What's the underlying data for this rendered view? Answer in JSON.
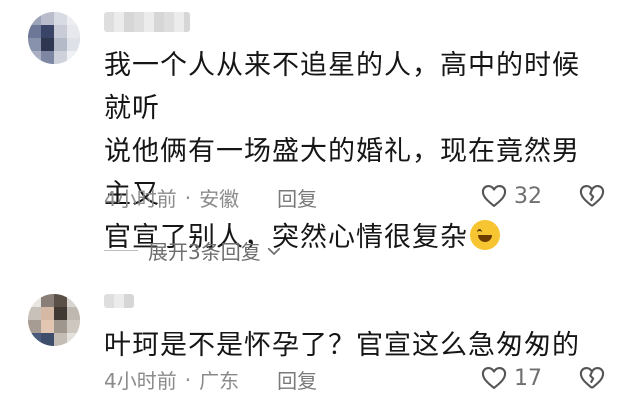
{
  "comments": [
    {
      "username": "",
      "text_lines": [
        "我一个人从来不追星的人，高中的时候就听",
        "说他俩有一场盛大的婚礼，现在竟然男主又",
        "官宣了别人，突然心情很复杂"
      ],
      "emoji": "laughing-crying-emoji",
      "time": "4小时前",
      "location": "安徽",
      "reply_label": "回复",
      "likes": "32",
      "expand_label": "展开3条回复"
    },
    {
      "username": "",
      "text_lines": [
        "叶珂是不是怀孕了？官宣这么急匆匆的"
      ],
      "time": "4小时前",
      "location": "广东",
      "reply_label": "回复",
      "likes": "17"
    }
  ],
  "separator": "·",
  "colors": {
    "text": "#161616",
    "meta": "#8b8b8b",
    "background": "#ffffff"
  }
}
